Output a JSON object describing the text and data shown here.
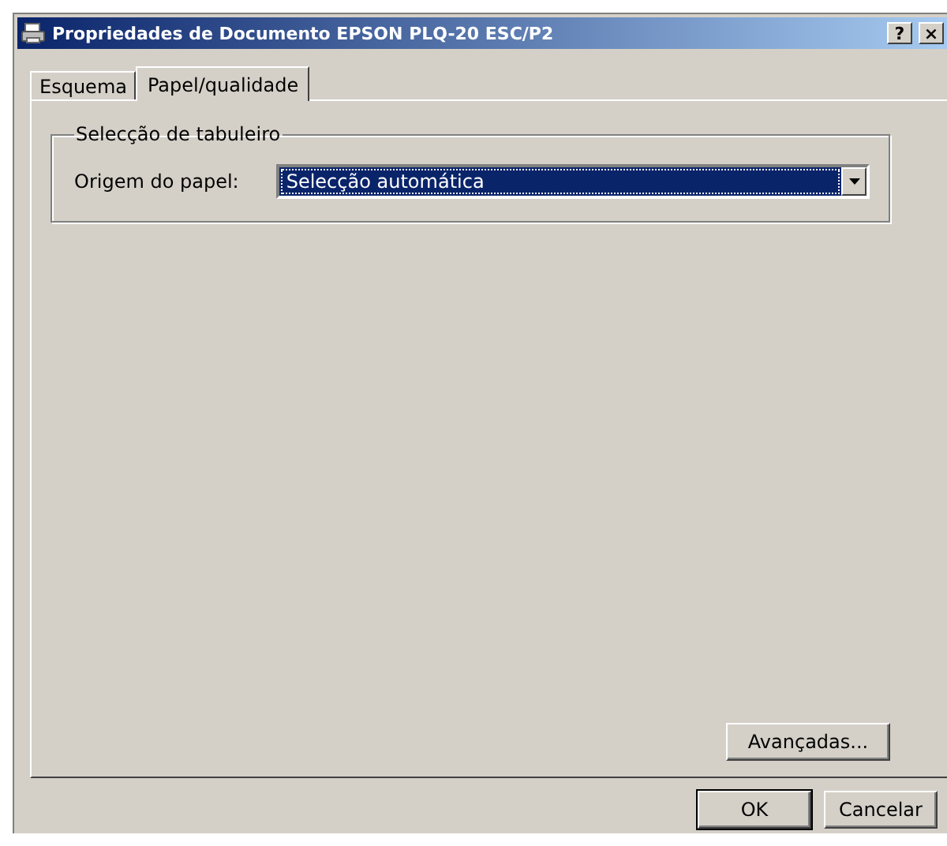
{
  "window": {
    "title": "Propriedades de Documento EPSON PLQ-20 ESC/P2",
    "buttons": [
      "?",
      "×"
    ]
  },
  "tabs": [
    {
      "label": "Esquema",
      "selected": false
    },
    {
      "label": "Papel/qualidade",
      "selected": true
    }
  ],
  "group": {
    "title": "Selecção de tabuleiro",
    "field_label": "Origem do papel:",
    "dropdown": {
      "value": "Selecção automática",
      "focused": true
    }
  },
  "advanced_button": "Avançadas...",
  "buttons": [
    "OK",
    "Cancelar"
  ]
}
